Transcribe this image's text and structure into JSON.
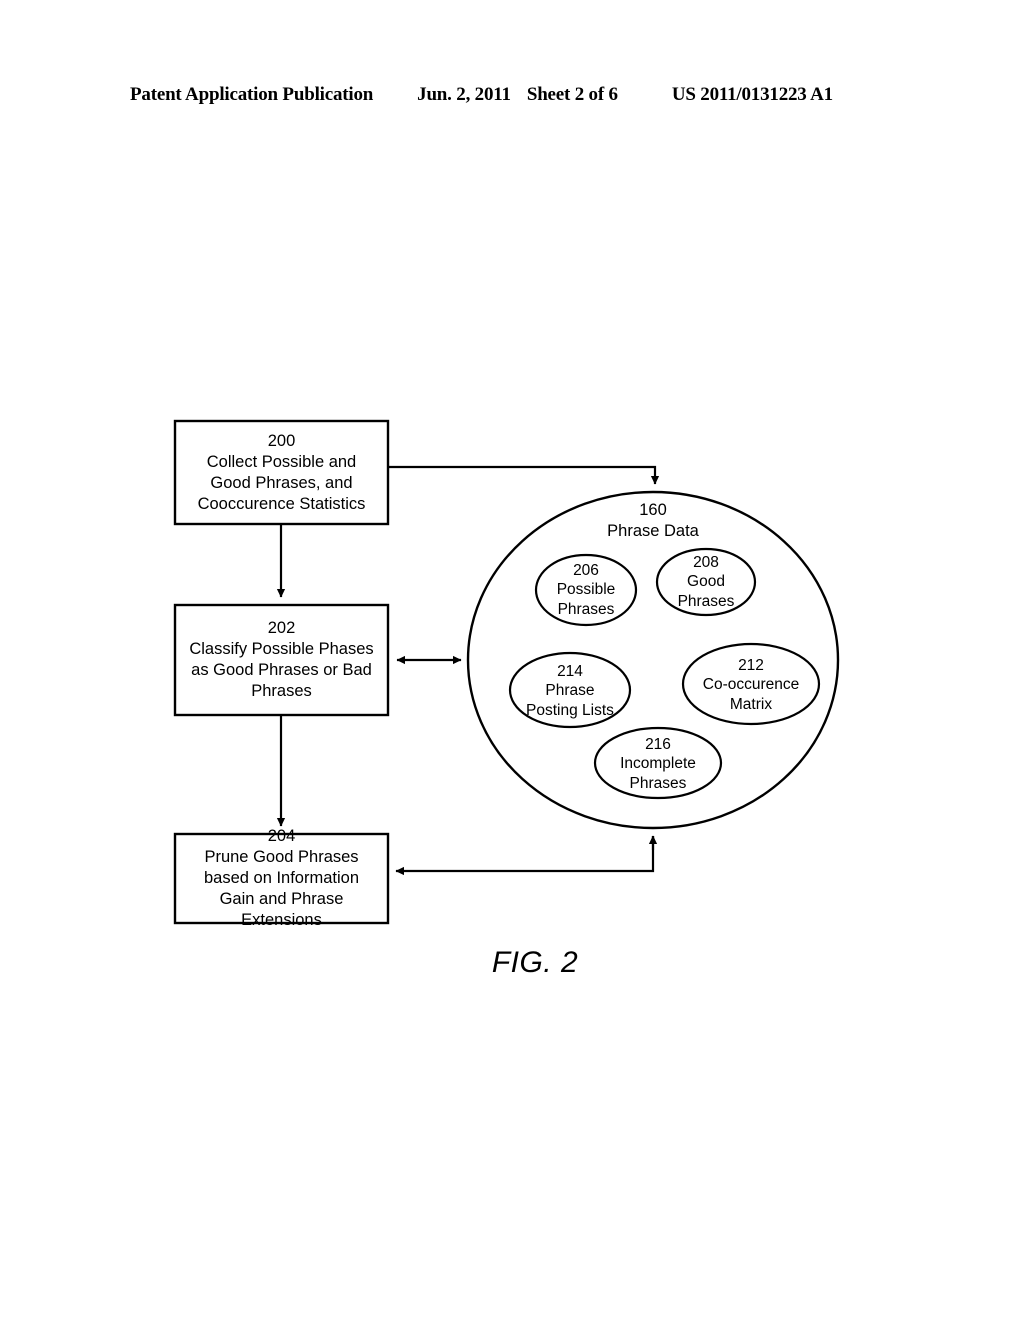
{
  "header": {
    "publication": "Patent Application Publication",
    "date": "Jun. 2, 2011",
    "sheet": "Sheet 2 of 6",
    "patent_number": "US 2011/0131223 A1"
  },
  "figure": {
    "caption": "FIG. 2",
    "process_boxes": [
      {
        "ref": "200",
        "label": "Collect Possible and\nGood Phrases, and\nCooccurence Statistics"
      },
      {
        "ref": "202",
        "label": "Classify Possible Phases\nas Good Phrases or Bad\nPhrases"
      },
      {
        "ref": "204",
        "label": "Prune Good Phrases\nbased on Information\nGain and Phrase\nExtensions"
      }
    ],
    "data_store": {
      "ref": "160",
      "label": "Phrase Data",
      "items": [
        {
          "ref": "206",
          "label": "Possible\nPhrases"
        },
        {
          "ref": "208",
          "label": "Good\nPhrases"
        },
        {
          "ref": "214",
          "label": "Phrase\nPosting Lists"
        },
        {
          "ref": "212",
          "label": "Co-occurence\nMatrix"
        },
        {
          "ref": "216",
          "label": "Incomplete\nPhrases"
        }
      ]
    },
    "connectors": [
      {
        "name": "box200-to-phrase-data",
        "style": "single-arrow"
      },
      {
        "name": "box200-to-box202",
        "style": "single-arrow"
      },
      {
        "name": "box202-to-phrase-data",
        "style": "double-arrow"
      },
      {
        "name": "box202-to-box204",
        "style": "single-arrow"
      },
      {
        "name": "phrase-data-to-box204",
        "style": "double-arrow"
      }
    ],
    "colors": {
      "ink": "#000000",
      "paper": "#ffffff"
    }
  }
}
